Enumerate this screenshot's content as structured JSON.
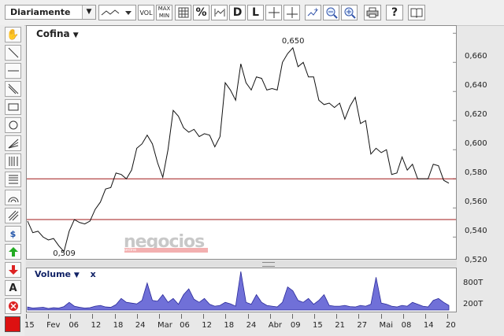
{
  "toolbar": {
    "period_select": "Diariamente",
    "vol_label": "VOL",
    "maxmin_label": "MAX\nMIN",
    "pct_label": "%",
    "d_label": "D",
    "l_label": "L",
    "help_label": "?"
  },
  "chart": {
    "instrument": "Cofina",
    "watermark": "negocios",
    "watermark_sub": "online"
  },
  "volume_panel": {
    "title": "Volume",
    "close": "x",
    "labels": [
      "800T",
      "200T"
    ]
  },
  "chart_data": {
    "type": "line",
    "series": [
      {
        "values": [
          0.531,
          0.523,
          0.524,
          0.52,
          0.518,
          0.519,
          0.514,
          0.51,
          0.524,
          0.532,
          0.53,
          0.529,
          0.531,
          0.539,
          0.544,
          0.553,
          0.554,
          0.564,
          0.563,
          0.56,
          0.566,
          0.581,
          0.584,
          0.59,
          0.584,
          0.571,
          0.561,
          0.58,
          0.607,
          0.603,
          0.595,
          0.592,
          0.594,
          0.589,
          0.591,
          0.59,
          0.582,
          0.589,
          0.626,
          0.621,
          0.614,
          0.639,
          0.626,
          0.621,
          0.63,
          0.629,
          0.621,
          0.622,
          0.621,
          0.64,
          0.646,
          0.65,
          0.637,
          0.64,
          0.63,
          0.63,
          0.614,
          0.611,
          0.612,
          0.609,
          0.612,
          0.601,
          0.61,
          0.616,
          0.598,
          0.6,
          0.577,
          0.581,
          0.578,
          0.58,
          0.563,
          0.564,
          0.575,
          0.566,
          0.57,
          0.56,
          0.56,
          0.56,
          0.57,
          0.569,
          0.559,
          0.557
        ]
      }
    ],
    "volume_values": [
      0.08,
      0.05,
      0.06,
      0.07,
      0.04,
      0.06,
      0.05,
      0.09,
      0.2,
      0.1,
      0.07,
      0.05,
      0.06,
      0.1,
      0.12,
      0.08,
      0.07,
      0.14,
      0.3,
      0.2,
      0.18,
      0.16,
      0.25,
      0.7,
      0.25,
      0.23,
      0.4,
      0.2,
      0.3,
      0.15,
      0.4,
      0.55,
      0.28,
      0.2,
      0.3,
      0.15,
      0.1,
      0.12,
      0.2,
      0.16,
      0.1,
      1.0,
      0.2,
      0.15,
      0.4,
      0.2,
      0.12,
      0.1,
      0.08,
      0.2,
      0.6,
      0.5,
      0.25,
      0.2,
      0.3,
      0.15,
      0.25,
      0.4,
      0.12,
      0.1,
      0.1,
      0.12,
      0.09,
      0.08,
      0.12,
      0.1,
      0.15,
      0.85,
      0.18,
      0.15,
      0.1,
      0.08,
      0.12,
      0.1,
      0.2,
      0.15,
      0.1,
      0.08,
      0.25,
      0.3,
      0.2,
      0.12
    ],
    "y_ticks": [
      "0,660",
      "0,640",
      "0,620",
      "0,600",
      "0,580",
      "0,560",
      "0,540",
      "0,520"
    ],
    "ylim": [
      0.505,
      0.665
    ],
    "x_ticks": [
      "15",
      "Fev",
      "06",
      "12",
      "18",
      "24",
      "Mar",
      "06",
      "12",
      "18",
      "24",
      "Abr",
      "09",
      "15",
      "21",
      "27",
      "Mai",
      "08",
      "14",
      "20"
    ],
    "hlines": [
      0.56,
      0.532
    ],
    "annotations": [
      {
        "text": "0,650",
        "value": 0.65
      },
      {
        "text": "0,509",
        "value": 0.509
      }
    ]
  }
}
